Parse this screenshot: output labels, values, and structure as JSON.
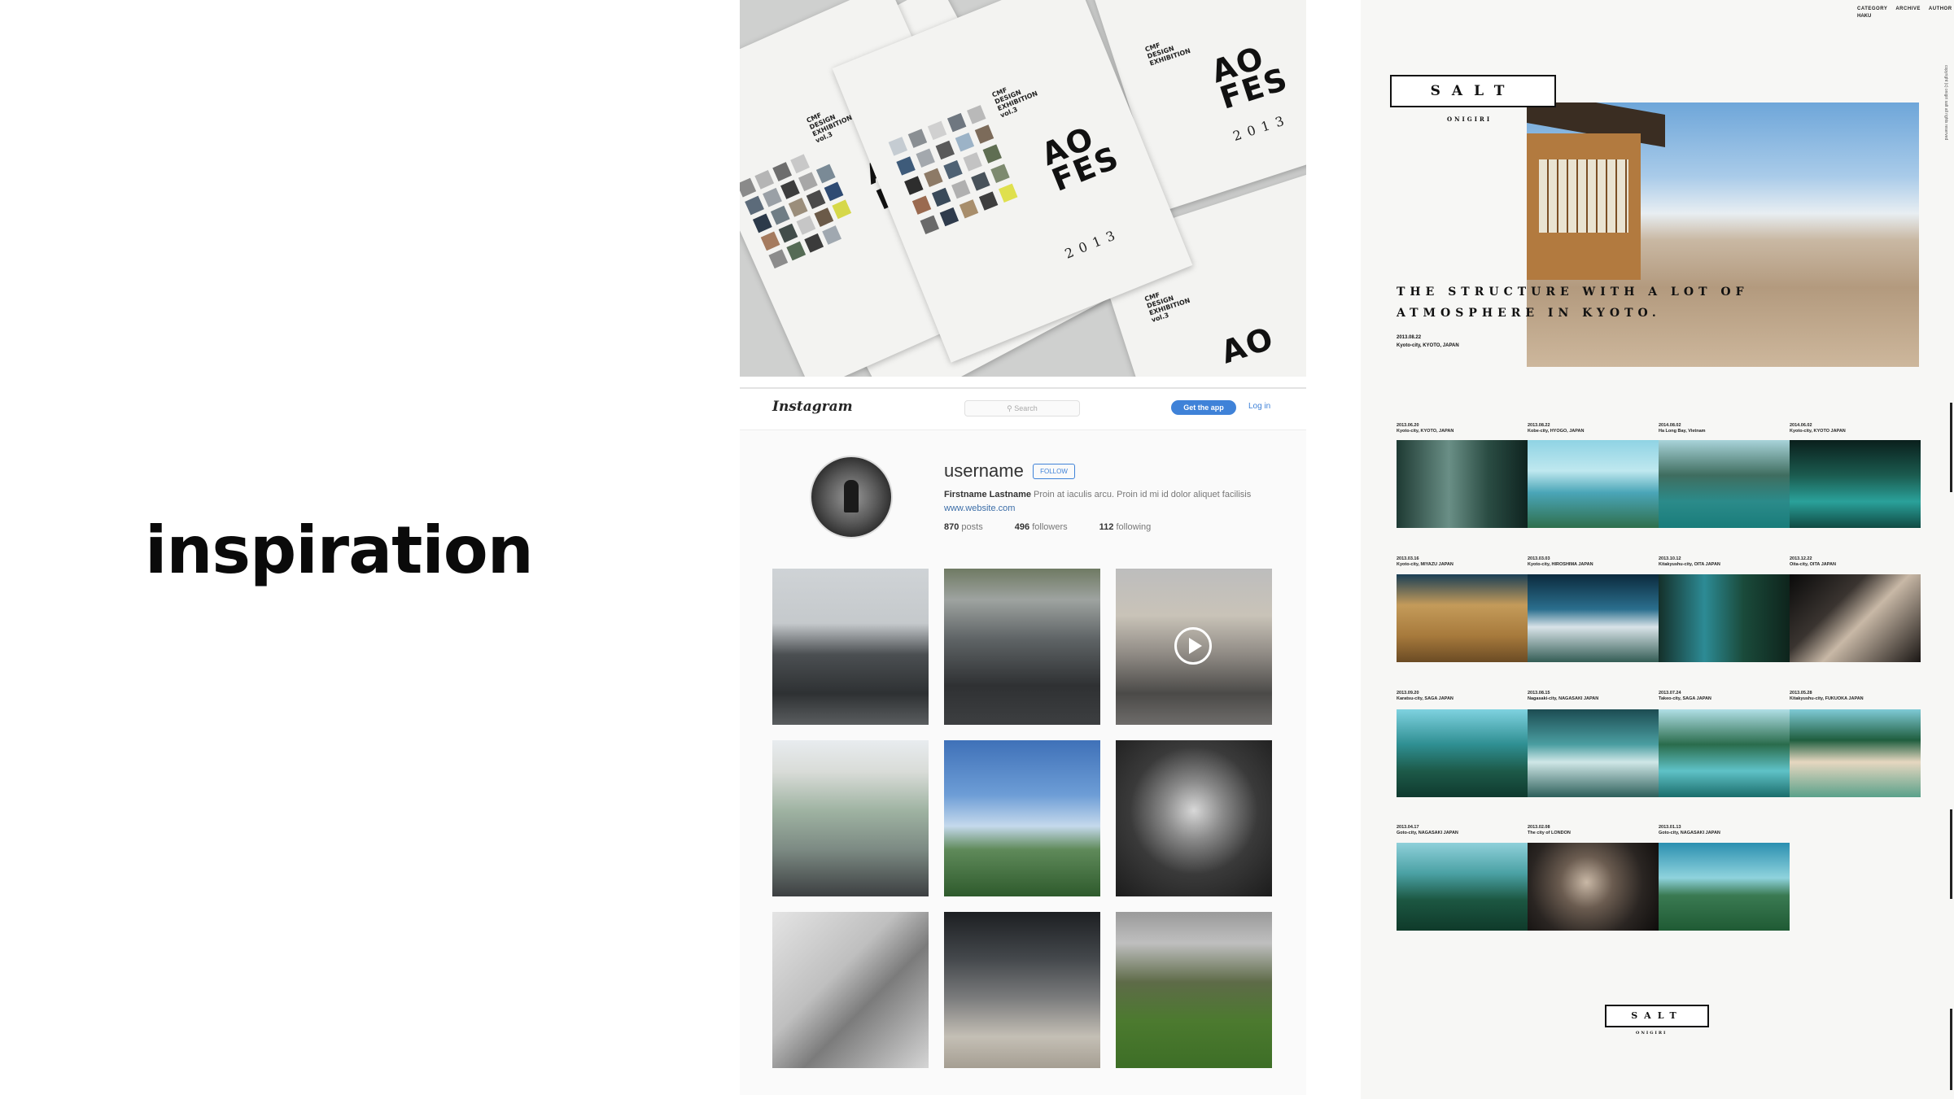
{
  "slide": {
    "title": "inspiration"
  },
  "aofes": {
    "brand_line1": "CMF",
    "brand_line2": "DESIGN",
    "brand_line3": "EXHIBITION",
    "brand_line4": "vol.3",
    "big_line1": "AO",
    "big_line2": "FES",
    "year": "2013"
  },
  "instagram": {
    "logo": "Instagram",
    "search_placeholder": "Search",
    "get_app": "Get the app",
    "login": "Log in",
    "username": "username",
    "follow": "FOLLOW",
    "bio_name": "Firstname Lastname",
    "bio_text": "Proin at iaculis arcu. Proin id mi id dolor aliquet facilisis",
    "website": "www.website.com",
    "posts_count": "870",
    "posts_label": "posts",
    "followers_count": "496",
    "followers_label": "followers",
    "following_count": "112",
    "following_label": "following"
  },
  "salt": {
    "nav": [
      "CATEGORY",
      "ARCHIVE",
      "AUTHOR"
    ],
    "nav_sub": "HAKU",
    "logo": "SALT",
    "logo_sub": "ONIGIRI",
    "headline1": "THE STRUCTURE WITH A LOT OF",
    "headline2": "ATMOSPHERE IN KYOTO.",
    "meta_date": "2013.08.22",
    "meta_place": "Kyoto-city, KYOTO, JAPAN",
    "captions": [
      [
        "2013.06.20",
        "Kyoto-city, KYOTO, JAPAN"
      ],
      [
        "2013.08.22",
        "Kobe-city, HYOGO, JAPAN"
      ],
      [
        "2014.08.02",
        "Ha Long Bay, Vietnam"
      ],
      [
        "2014.06.02",
        "Kyoto-city, KYOTO JAPAN"
      ],
      [
        "2013.03.16",
        "Kyoto-city, MIYAZU JAPAN"
      ],
      [
        "2013.03.03",
        "Kyoto-city, HIROSHIMA JAPAN"
      ],
      [
        "2013.10.12",
        "Kitakyushu-city, OITA JAPAN"
      ],
      [
        "2013.12.22",
        "Oita-city, OITA JAPAN"
      ],
      [
        "2013.09.20",
        "Karatsu-city, SAGA JAPAN"
      ],
      [
        "2013.08.15",
        "Nagasaki-city, NAGASAKI JAPAN"
      ],
      [
        "2013.07.24",
        "Takeo-city, SAGA JAPAN"
      ],
      [
        "2013.05.28",
        "Kitakyushu-city, FUKUOKA JAPAN"
      ],
      [
        "2013.04.17",
        "Goto-city, NAGASAKI JAPAN"
      ],
      [
        "2013.02.08",
        "The city of LONDON"
      ],
      [
        "2013.01.13",
        "Goto-city, NAGASAKI JAPAN"
      ]
    ],
    "footer_logo": "SALT",
    "footer_sub": "ONIGIRI",
    "side_text": "copyright (c) onigiri salt all rights reserved"
  }
}
